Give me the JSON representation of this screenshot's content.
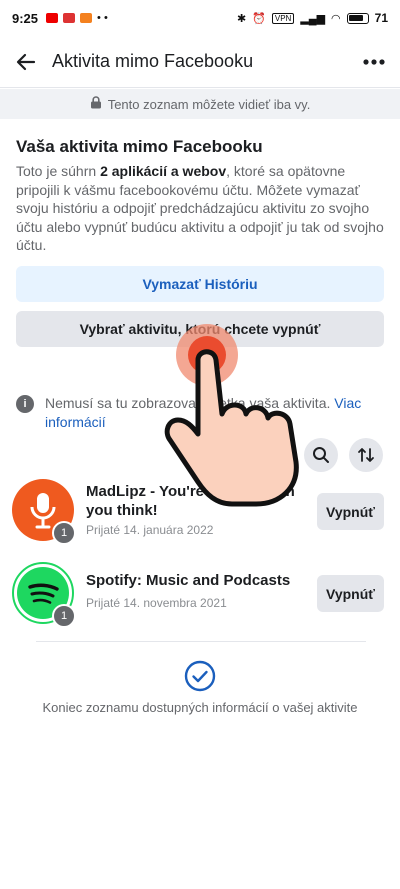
{
  "status_bar": {
    "time": "9:25",
    "battery": "71"
  },
  "app_bar": {
    "title": "Aktivita mimo Facebooku"
  },
  "privacy_banner": {
    "text": "Tento zoznam môžete vidieť iba vy."
  },
  "intro": {
    "title": "Vaša aktivita mimo Facebooku",
    "desc_prefix": "Toto je súhrn ",
    "desc_bold": "2 aplikácií a webov",
    "desc_suffix": ", ktoré sa opätovne pripojili k vášmu facebookovému účtu. Môžete vymazať svoju históriu a odpojiť predchádzajúcu aktivitu zo svojho účtu alebo vypnúť budúcu aktivitu a odpojiť ju tak od svojho účtu."
  },
  "buttons": {
    "clear_history": "Vymazať Históriu",
    "choose_activity": "Vybrať aktivitu, ktorú chcete vypnúť"
  },
  "info": {
    "text": "Nemusí sa tu zobrazovať všetka vaša aktivita. ",
    "link": "Viac informácií"
  },
  "apps": [
    {
      "name": "MadLipz - You're funnier than you think!",
      "date": "Prijaté 14. januára 2022",
      "badge": "1",
      "off_label": "Vypnúť"
    },
    {
      "name": "Spotify: Music and Podcasts",
      "date": "Prijaté 14. novembra 2021",
      "badge": "1",
      "off_label": "Vypnúť"
    }
  ],
  "footer": {
    "end_text": "Koniec zoznamu dostupných informácií o vašej aktivite"
  },
  "colors": {
    "accent": "#1b5fbd",
    "madlipz": "#ef5a1f",
    "spotify": "#1ed760"
  },
  "icons": [
    "back-arrow-icon",
    "more-dots-icon",
    "lock-icon",
    "info-icon",
    "search-icon",
    "sort-icon",
    "check-circle-icon",
    "hand-pointer-icon"
  ]
}
